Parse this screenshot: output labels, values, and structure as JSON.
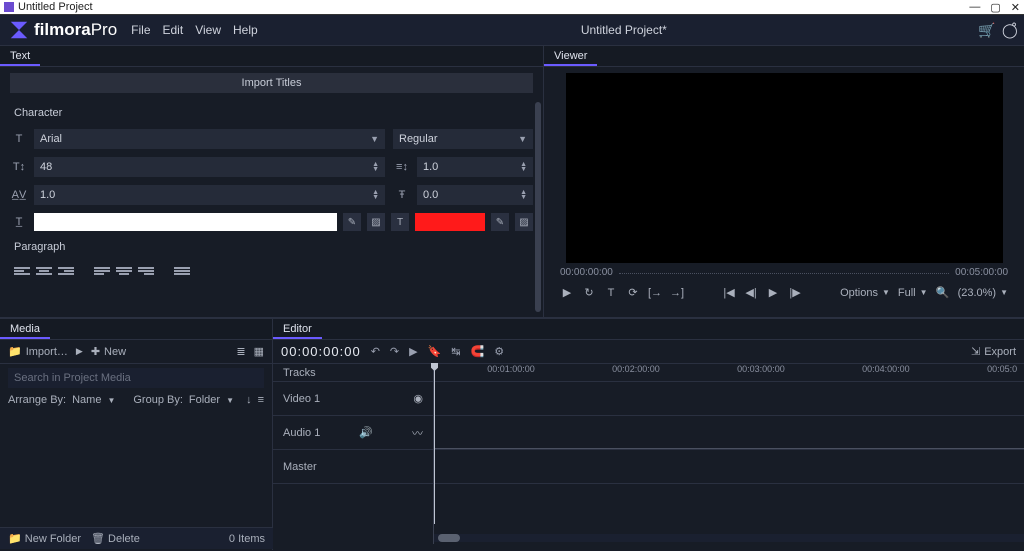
{
  "titlebar": {
    "title": "Untitled Project"
  },
  "appbar": {
    "brand_main": "filmora",
    "brand_sub": "Pro",
    "menu": [
      "File",
      "Edit",
      "View",
      "Help"
    ],
    "project": "Untitled Project*"
  },
  "tabs_left": "Text",
  "tabs_right": "Viewer",
  "text_panel": {
    "import_titles": "Import Titles",
    "character": "Character",
    "font": "Arial",
    "style": "Regular",
    "size": "48",
    "leading": "1.0",
    "tracking": "1.0",
    "baseline": "0.0",
    "paragraph": "Paragraph"
  },
  "viewer": {
    "time_left": "00:00:00:00",
    "time_right": "00:05:00:00",
    "options": "Options",
    "full": "Full",
    "zoom": "(23.0%)"
  },
  "media": {
    "tab": "Media",
    "import": "Import…",
    "new": "New",
    "search_placeholder": "Search in Project Media",
    "arrange_label": "Arrange By:",
    "arrange_value": "Name",
    "group_label": "Group By:",
    "group_value": "Folder",
    "new_folder": "New Folder",
    "delete": "Delete",
    "items": "0 Items"
  },
  "editor": {
    "tab": "Editor",
    "timecode": "00:00:00:00",
    "export": "Export",
    "tracks_label": "Tracks",
    "video1": "Video 1",
    "audio1": "Audio 1",
    "master": "Master",
    "ruler": [
      "00:01:00:00",
      "00:02:00:00",
      "00:03:00:00",
      "00:04:00:00",
      "00:05:0"
    ]
  }
}
